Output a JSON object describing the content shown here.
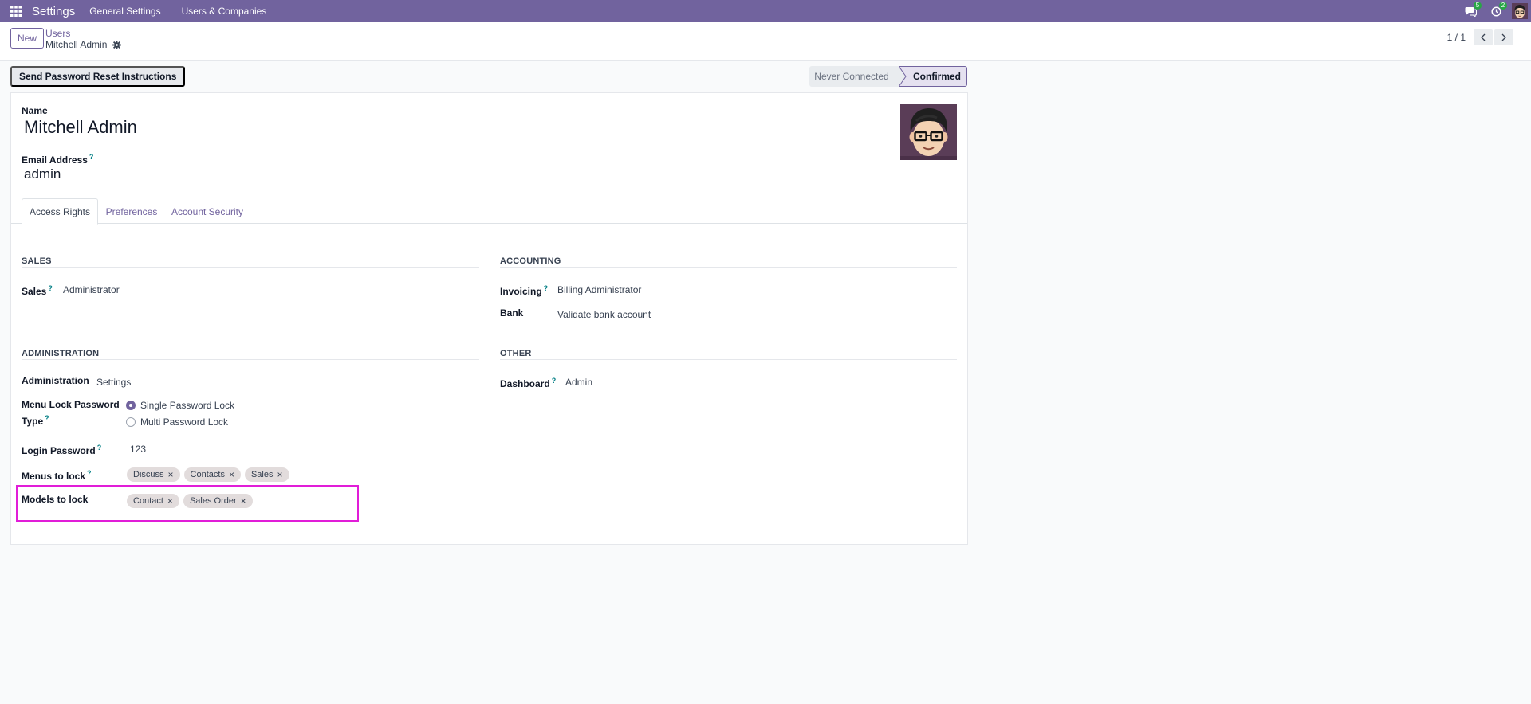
{
  "navbar": {
    "brand": "Settings",
    "menus": [
      "General Settings",
      "Users & Companies"
    ],
    "messages_count": "5",
    "activities_count": "2",
    "accent": "#71639e"
  },
  "control_panel": {
    "new_label": "New",
    "breadcrumb_parent": "Users",
    "breadcrumb_current": "Mitchell Admin",
    "pager_value": "1 / 1"
  },
  "status_bar": {
    "reset_button": "Send Password Reset Instructions",
    "steps": [
      "Never Connected",
      "Confirmed"
    ],
    "active_step": "Confirmed"
  },
  "form": {
    "name_label": "Name",
    "name_value": "Mitchell Admin",
    "email_label": "Email Address",
    "email_help": "?",
    "email_value": "admin",
    "tabs": [
      "Access Rights",
      "Preferences",
      "Account Security"
    ],
    "active_tab": "Access Rights",
    "groups": {
      "sales": {
        "title": "SALES",
        "fields": [
          {
            "label": "Sales",
            "help": "?",
            "value": "Administrator"
          }
        ]
      },
      "accounting": {
        "title": "ACCOUNTING",
        "fields": [
          {
            "label": "Invoicing",
            "help": "?",
            "value": "Billing Administrator"
          },
          {
            "label": "Bank",
            "value": "Validate bank account"
          }
        ]
      },
      "administration": {
        "title": "ADMINISTRATION",
        "administration_label": "Administration",
        "administration_value": "Settings",
        "menu_lock_label_1": "Menu Lock Password",
        "menu_lock_label_2": "Type",
        "menu_lock_help": "?",
        "menu_lock_options": [
          "Single Password Lock",
          "Multi Password Lock"
        ],
        "menu_lock_selected": "Single Password Lock",
        "login_password_label": "Login Password",
        "login_password_help": "?",
        "login_password_value": "123",
        "menus_to_lock_label": "Menus to lock",
        "menus_to_lock_help": "?",
        "menus_to_lock": [
          "Discuss",
          "Contacts",
          "Sales"
        ],
        "models_to_lock_label": "Models to lock",
        "models_to_lock": [
          "Contact",
          "Sales Order"
        ]
      },
      "other": {
        "title": "OTHER",
        "fields": [
          {
            "label": "Dashboard",
            "help": "?",
            "value": "Admin"
          }
        ]
      }
    },
    "tag_remove_glyph": "×"
  }
}
